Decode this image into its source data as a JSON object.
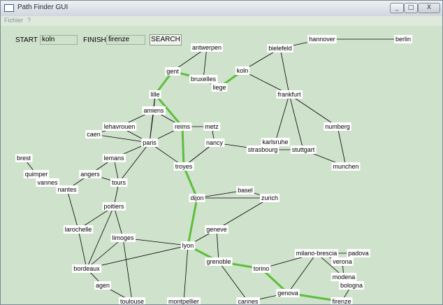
{
  "window": {
    "title": "Path Finder GUI",
    "controls": {
      "minimize": "_",
      "maximize": "□",
      "close": "X"
    }
  },
  "menu": {
    "items": [
      "Fichier",
      "?"
    ]
  },
  "toolbar": {
    "start_label": "START",
    "start_value": "koln",
    "finish_label": "FINISH",
    "finish_value": "firenze",
    "search_label": "SEARCH"
  },
  "colors": {
    "background": "#cfe2cc",
    "edge": "#000000",
    "path": "#5cbf3b",
    "label_bg": "#ffffff"
  },
  "graph": {
    "nodes": [
      {
        "id": "hannover",
        "label": "hannover"
      },
      {
        "id": "berlin",
        "label": "berlin"
      },
      {
        "id": "antwerpen",
        "label": "antwerpen"
      },
      {
        "id": "bielefeld",
        "label": "bielefeld"
      },
      {
        "id": "gent",
        "label": "gent"
      },
      {
        "id": "koln",
        "label": "koln"
      },
      {
        "id": "bruxelles",
        "label": "bruxelles"
      },
      {
        "id": "liege",
        "label": "liege"
      },
      {
        "id": "lille",
        "label": "lille"
      },
      {
        "id": "frankfurt",
        "label": "frankfurt"
      },
      {
        "id": "amiens",
        "label": "amiens"
      },
      {
        "id": "lehavrouen",
        "label": "lehavrouen"
      },
      {
        "id": "reims",
        "label": "reims"
      },
      {
        "id": "metz",
        "label": "metz"
      },
      {
        "id": "caen",
        "label": "caen"
      },
      {
        "id": "numberg",
        "label": "numberg"
      },
      {
        "id": "paris",
        "label": "paris"
      },
      {
        "id": "nancy",
        "label": "nancy"
      },
      {
        "id": "karlsruhe",
        "label": "karlsruhe"
      },
      {
        "id": "strasbourg",
        "label": "strasbourg"
      },
      {
        "id": "stuttgart",
        "label": "stuttgart"
      },
      {
        "id": "brest",
        "label": "brest"
      },
      {
        "id": "lemans",
        "label": "lemans"
      },
      {
        "id": "troyes",
        "label": "troyes"
      },
      {
        "id": "munchen",
        "label": "munchen"
      },
      {
        "id": "quimper",
        "label": "quimper"
      },
      {
        "id": "angers",
        "label": "angers"
      },
      {
        "id": "vannes",
        "label": "vannes"
      },
      {
        "id": "tours",
        "label": "tours"
      },
      {
        "id": "nantes",
        "label": "nantes"
      },
      {
        "id": "basel",
        "label": "basel"
      },
      {
        "id": "dijon",
        "label": "dijon"
      },
      {
        "id": "zurich",
        "label": "zurich"
      },
      {
        "id": "poitiers",
        "label": "poitiers"
      },
      {
        "id": "larochelle",
        "label": "larochelle"
      },
      {
        "id": "geneve",
        "label": "geneve"
      },
      {
        "id": "limoges",
        "label": "limoges"
      },
      {
        "id": "lyon",
        "label": "lyon"
      },
      {
        "id": "milano",
        "label": "milano-brescia"
      },
      {
        "id": "padova",
        "label": "padova"
      },
      {
        "id": "verona",
        "label": "verona"
      },
      {
        "id": "grenoble",
        "label": "grenoble"
      },
      {
        "id": "bordeaux",
        "label": "bordeaux"
      },
      {
        "id": "torino",
        "label": "torino"
      },
      {
        "id": "modena",
        "label": "modena"
      },
      {
        "id": "agen",
        "label": "agen"
      },
      {
        "id": "bologna",
        "label": "bologna"
      },
      {
        "id": "genova",
        "label": "genova"
      },
      {
        "id": "toulouse",
        "label": "toulouse"
      },
      {
        "id": "montpellier",
        "label": "montpellier"
      },
      {
        "id": "cannes",
        "label": "cannes"
      },
      {
        "id": "firenze",
        "label": "firenze"
      }
    ],
    "path": [
      "koln",
      "liege",
      "bruxelles",
      "gent",
      "lille",
      "reims",
      "troyes",
      "dijon",
      "lyon",
      "grenoble",
      "torino",
      "genova",
      "firenze"
    ],
    "edges": [
      [
        "hannover",
        "berlin"
      ],
      [
        "hannover",
        "bielefeld"
      ],
      [
        "bielefeld",
        "koln"
      ],
      [
        "bielefeld",
        "frankfurt"
      ],
      [
        "antwerpen",
        "gent"
      ],
      [
        "antwerpen",
        "bruxelles"
      ],
      [
        "gent",
        "bruxelles"
      ],
      [
        "gent",
        "lille"
      ],
      [
        "bruxelles",
        "liege"
      ],
      [
        "liege",
        "koln"
      ],
      [
        "koln",
        "frankfurt"
      ],
      [
        "frankfurt",
        "karlsruhe"
      ],
      [
        "frankfurt",
        "numberg"
      ],
      [
        "frankfurt",
        "stuttgart"
      ],
      [
        "numberg",
        "munchen"
      ],
      [
        "stuttgart",
        "munchen"
      ],
      [
        "karlsruhe",
        "strasbourg"
      ],
      [
        "lille",
        "amiens"
      ],
      [
        "lille",
        "reims"
      ],
      [
        "lille",
        "paris"
      ],
      [
        "amiens",
        "lehavrouen"
      ],
      [
        "amiens",
        "paris"
      ],
      [
        "amiens",
        "reims"
      ],
      [
        "lehavrouen",
        "caen"
      ],
      [
        "lehavrouen",
        "paris"
      ],
      [
        "reims",
        "metz"
      ],
      [
        "reims",
        "paris"
      ],
      [
        "reims",
        "troyes"
      ],
      [
        "metz",
        "nancy"
      ],
      [
        "nancy",
        "strasbourg"
      ],
      [
        "nancy",
        "troyes"
      ],
      [
        "strasbourg",
        "stuttgart"
      ],
      [
        "paris",
        "lemans"
      ],
      [
        "paris",
        "troyes"
      ],
      [
        "paris",
        "tours"
      ],
      [
        "paris",
        "caen"
      ],
      [
        "brest",
        "quimper"
      ],
      [
        "quimper",
        "vannes"
      ],
      [
        "vannes",
        "nantes"
      ],
      [
        "nantes",
        "angers"
      ],
      [
        "nantes",
        "larochelle"
      ],
      [
        "angers",
        "lemans"
      ],
      [
        "angers",
        "tours"
      ],
      [
        "lemans",
        "tours"
      ],
      [
        "tours",
        "poitiers"
      ],
      [
        "troyes",
        "dijon"
      ],
      [
        "dijon",
        "basel"
      ],
      [
        "dijon",
        "lyon"
      ],
      [
        "dijon",
        "zurich"
      ],
      [
        "basel",
        "zurich"
      ],
      [
        "zurich",
        "geneve"
      ],
      [
        "poitiers",
        "larochelle"
      ],
      [
        "poitiers",
        "limoges"
      ],
      [
        "poitiers",
        "bordeaux"
      ],
      [
        "larochelle",
        "bordeaux"
      ],
      [
        "limoges",
        "bordeaux"
      ],
      [
        "limoges",
        "lyon"
      ],
      [
        "limoges",
        "toulouse"
      ],
      [
        "geneve",
        "lyon"
      ],
      [
        "geneve",
        "grenoble"
      ],
      [
        "lyon",
        "grenoble"
      ],
      [
        "lyon",
        "bordeaux"
      ],
      [
        "lyon",
        "montpellier"
      ],
      [
        "grenoble",
        "torino"
      ],
      [
        "grenoble",
        "cannes"
      ],
      [
        "torino",
        "genova"
      ],
      [
        "torino",
        "milano"
      ],
      [
        "milano",
        "verona"
      ],
      [
        "milano",
        "padova"
      ],
      [
        "milano",
        "modena"
      ],
      [
        "milano",
        "genova"
      ],
      [
        "verona",
        "padova"
      ],
      [
        "verona",
        "modena"
      ],
      [
        "modena",
        "bologna"
      ],
      [
        "bologna",
        "firenze"
      ],
      [
        "genova",
        "firenze"
      ],
      [
        "genova",
        "cannes"
      ],
      [
        "bordeaux",
        "agen"
      ],
      [
        "agen",
        "toulouse"
      ]
    ]
  }
}
